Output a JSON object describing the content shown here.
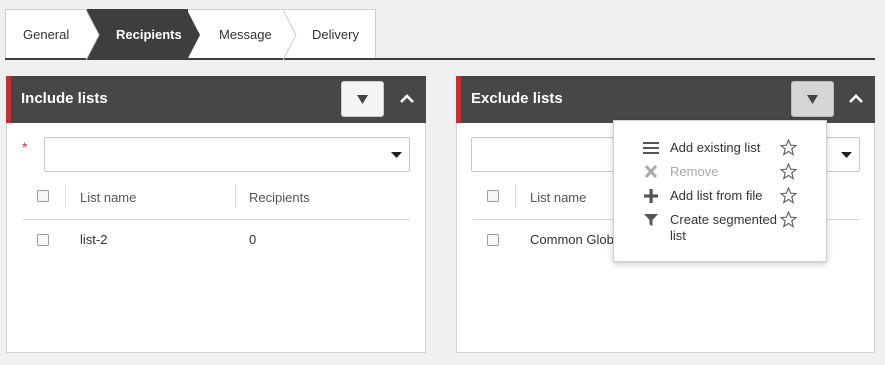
{
  "tabs": [
    {
      "label": "General",
      "active": false
    },
    {
      "label": "Recipients",
      "active": true
    },
    {
      "label": "Message",
      "active": false
    },
    {
      "label": "Delivery",
      "active": false
    }
  ],
  "include_panel": {
    "title": "Include lists",
    "required_marker": "*",
    "columns": [
      "List name",
      "Recipients"
    ],
    "rows": [
      {
        "list_name": "list-2",
        "recipients": "0"
      }
    ]
  },
  "exclude_panel": {
    "title": "Exclude lists",
    "columns": [
      "List name"
    ],
    "rows": [
      {
        "list_name": "Common Globa"
      }
    ]
  },
  "menu": {
    "items": [
      {
        "label": "Add existing list",
        "icon": "list-icon",
        "disabled": false
      },
      {
        "label": "Remove",
        "icon": "remove-x-icon",
        "disabled": true
      },
      {
        "label": "Add list from file",
        "icon": "plus-icon",
        "disabled": false
      },
      {
        "label": "Create segmented list",
        "icon": "filter-funnel-icon",
        "disabled": false
      }
    ]
  },
  "colors": {
    "header_bg": "#474747",
    "accent_red": "#d42a2a",
    "active_tab_bg": "#3e3e3e",
    "page_bg": "#f0f0f0"
  }
}
